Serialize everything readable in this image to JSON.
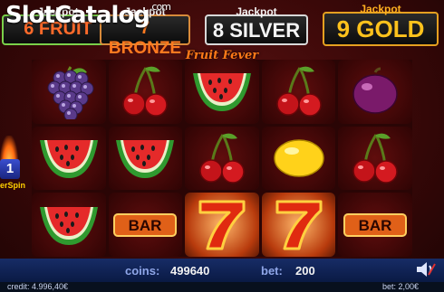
{
  "watermark": {
    "brand_a": "Slot",
    "brand_b": "Catalog",
    "suffix": ".com"
  },
  "jackpots": [
    {
      "title": "Jackpot",
      "value": "6 FRUIT"
    },
    {
      "title": "Jackpot",
      "value": "7 BRONZE"
    },
    {
      "title": "Jackpot",
      "value": "8 SILVER"
    },
    {
      "title": "Jackpot",
      "value": "9 GOLD"
    }
  ],
  "game_title": "Fruit Fever",
  "reels": [
    [
      "grapes",
      "watermelon",
      "watermelon"
    ],
    [
      "cherries",
      "watermelon",
      "bar"
    ],
    [
      "watermelon",
      "cherries",
      "seven"
    ],
    [
      "cherries",
      "lemon",
      "seven"
    ],
    [
      "plum",
      "cherries",
      "bar"
    ]
  ],
  "highlighted_cells": [
    "2-2",
    "3-2"
  ],
  "side_panel": {
    "count": "1",
    "label": "erSpin"
  },
  "status_bar": {
    "coins_label": "coins:",
    "coins_value": "499640",
    "bet_label": "bet:",
    "bet_value": "200"
  },
  "footer": {
    "credit": "credit: 4.996,40€",
    "bet": "bet: 2,00€"
  },
  "colors": {
    "accent": "#ff7a18",
    "bar": "#172c66",
    "gold": "#ffc21c"
  },
  "icons": {
    "sound": "speaker-icon"
  }
}
